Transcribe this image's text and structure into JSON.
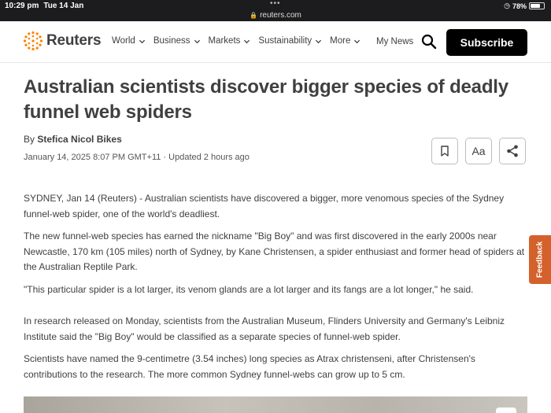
{
  "status_bar": {
    "time": "10:29 pm",
    "day": "Tue 14 Jan",
    "url": "reuters.com",
    "battery": "78%",
    "battery_level": 0.78,
    "dots": "•••"
  },
  "header": {
    "logo_text": "Reuters",
    "nav": [
      {
        "label": "World"
      },
      {
        "label": "Business"
      },
      {
        "label": "Markets"
      },
      {
        "label": "Sustainability"
      },
      {
        "label": "More"
      }
    ],
    "my_news": "My News",
    "subscribe": "Subscribe"
  },
  "article": {
    "headline": "Australian scientists discover bigger species of deadly funnel web spiders",
    "byline_prefix": "By",
    "author": "Stefica Nicol Bikes",
    "date": "January 14, 2025 8:07 PM GMT+11 · Updated 2 hours ago",
    "font_button": "Aa",
    "paragraphs": [
      "SYDNEY, Jan 14 (Reuters) - Australian scientists have discovered a bigger, more venomous species of the Sydney funnel-web spider, one of the world's deadliest.",
      "The new funnel-web species has earned the nickname \"Big Boy\" and was first discovered in the early 2000s near Newcastle, 170 km (105 miles) north of Sydney, by Kane Christensen, a spider enthusiast and former head of spiders at the Australian Reptile Park.",
      "\"This particular spider is a lot larger, its venom glands are a lot larger and its fangs are a lot longer,\" he said.",
      "In research released on Monday, scientists from the Australian Museum, Flinders University and Germany's Leibniz Institute said the \"Big Boy\" would be classified as a separate species of funnel-web spider.",
      "Scientists have named the 9-centimetre (3.54 inches) long species as Atrax christenseni, after Christensen's contributions to the research. The more common Sydney funnel-webs can grow up to 5 cm."
    ]
  },
  "feedback": "Feedback",
  "colors": {
    "brand_orange": "#d4612c",
    "subscribe_bg": "#000000",
    "text": "#404040"
  }
}
